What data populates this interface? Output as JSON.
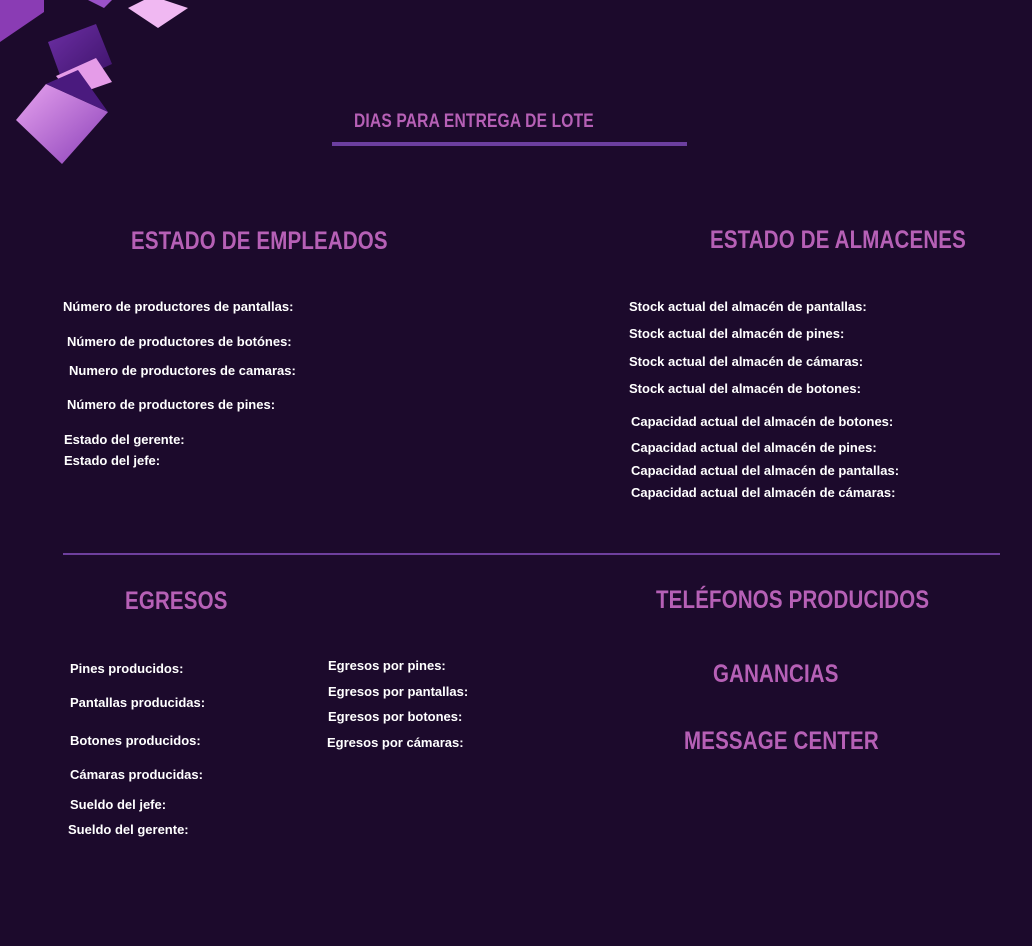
{
  "header": {
    "title": "DIAS PARA ENTREGA DE LOTE"
  },
  "empleados": {
    "title": "ESTADO DE EMPLEADOS",
    "items": [
      "Número de productores de pantallas:",
      "Número de productores de botónes:",
      "Numero de productores de camaras:",
      "Número de productores de pines:",
      "Estado del gerente:",
      "Estado del jefe:"
    ]
  },
  "almacenes": {
    "title": "ESTADO DE ALMACENES",
    "items": [
      "Stock actual del almacén de pantallas:",
      "Stock actual del almacén de pines:",
      "Stock actual del almacén de cámaras:",
      "Stock actual del almacén de botones:",
      "Capacidad actual del almacén de botones:",
      "Capacidad actual del almacén de pines:",
      "Capacidad actual del almacén de pantallas:",
      "Capacidad actual del almacén de cámaras:"
    ]
  },
  "egresos": {
    "title": "EGRESOS",
    "left_items": [
      "Pines producidos:",
      "Pantallas producidas:",
      "Botones producidos:",
      "Cámaras producidas:",
      "Sueldo del jefe:",
      "Sueldo del gerente:"
    ],
    "right_items": [
      "Egresos por pines:",
      "Egresos por pantallas:",
      "Egresos por botones:",
      "Egresos por cámaras:"
    ]
  },
  "telefonos": {
    "title": "TELÉFONOS PRODUCIDOS"
  },
  "ganancias": {
    "title": "GANANCIAS"
  },
  "messages": {
    "title": "MESSAGE CENTER"
  },
  "colors": {
    "background": "#1c0a2c",
    "heading": "#b660b6",
    "divider": "#6e3f9e",
    "text": "#ffffff"
  },
  "decoration": {
    "icon": "floating-cubes-icon"
  }
}
